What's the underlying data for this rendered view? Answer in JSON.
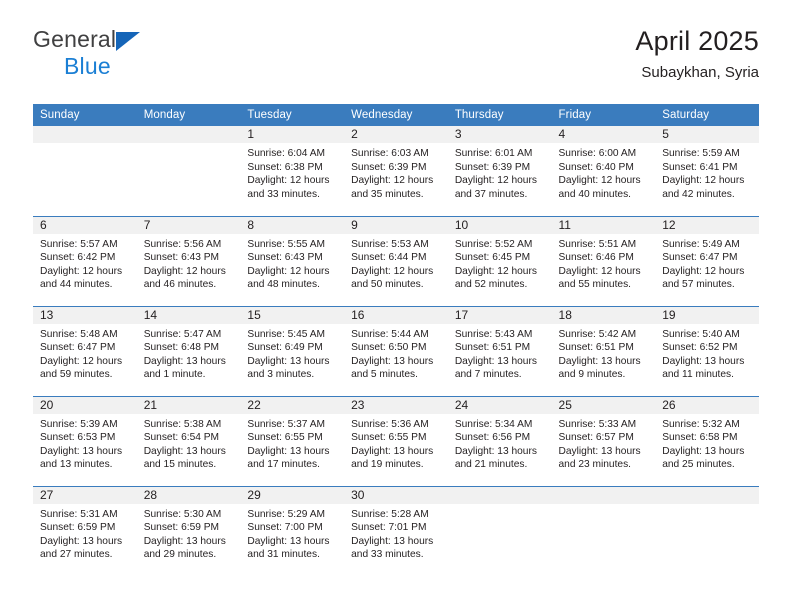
{
  "brand": {
    "name_line1": "General",
    "name_line2": "Blue",
    "triangle_color": "#1565b8",
    "blue_text_color": "#1b7fd4"
  },
  "header": {
    "title": "April 2025",
    "subtitle": "Subaykhan, Syria"
  },
  "theme": {
    "header_row_bg": "#3a7cbe",
    "header_row_text": "#ffffff",
    "daynum_bg": "#f1f1f1",
    "row_divider": "#3a7cbe",
    "body_text": "#231f20"
  },
  "calendar": {
    "weekday_headers": [
      "Sunday",
      "Monday",
      "Tuesday",
      "Wednesday",
      "Thursday",
      "Friday",
      "Saturday"
    ],
    "weeks": [
      [
        {
          "day": "",
          "sunrise": "",
          "sunset": "",
          "daylight": "",
          "empty": true
        },
        {
          "day": "",
          "sunrise": "",
          "sunset": "",
          "daylight": "",
          "empty": true
        },
        {
          "day": "1",
          "sunrise": "Sunrise: 6:04 AM",
          "sunset": "Sunset: 6:38 PM",
          "daylight": "Daylight: 12 hours and 33 minutes."
        },
        {
          "day": "2",
          "sunrise": "Sunrise: 6:03 AM",
          "sunset": "Sunset: 6:39 PM",
          "daylight": "Daylight: 12 hours and 35 minutes."
        },
        {
          "day": "3",
          "sunrise": "Sunrise: 6:01 AM",
          "sunset": "Sunset: 6:39 PM",
          "daylight": "Daylight: 12 hours and 37 minutes."
        },
        {
          "day": "4",
          "sunrise": "Sunrise: 6:00 AM",
          "sunset": "Sunset: 6:40 PM",
          "daylight": "Daylight: 12 hours and 40 minutes."
        },
        {
          "day": "5",
          "sunrise": "Sunrise: 5:59 AM",
          "sunset": "Sunset: 6:41 PM",
          "daylight": "Daylight: 12 hours and 42 minutes."
        }
      ],
      [
        {
          "day": "6",
          "sunrise": "Sunrise: 5:57 AM",
          "sunset": "Sunset: 6:42 PM",
          "daylight": "Daylight: 12 hours and 44 minutes."
        },
        {
          "day": "7",
          "sunrise": "Sunrise: 5:56 AM",
          "sunset": "Sunset: 6:43 PM",
          "daylight": "Daylight: 12 hours and 46 minutes."
        },
        {
          "day": "8",
          "sunrise": "Sunrise: 5:55 AM",
          "sunset": "Sunset: 6:43 PM",
          "daylight": "Daylight: 12 hours and 48 minutes."
        },
        {
          "day": "9",
          "sunrise": "Sunrise: 5:53 AM",
          "sunset": "Sunset: 6:44 PM",
          "daylight": "Daylight: 12 hours and 50 minutes."
        },
        {
          "day": "10",
          "sunrise": "Sunrise: 5:52 AM",
          "sunset": "Sunset: 6:45 PM",
          "daylight": "Daylight: 12 hours and 52 minutes."
        },
        {
          "day": "11",
          "sunrise": "Sunrise: 5:51 AM",
          "sunset": "Sunset: 6:46 PM",
          "daylight": "Daylight: 12 hours and 55 minutes."
        },
        {
          "day": "12",
          "sunrise": "Sunrise: 5:49 AM",
          "sunset": "Sunset: 6:47 PM",
          "daylight": "Daylight: 12 hours and 57 minutes."
        }
      ],
      [
        {
          "day": "13",
          "sunrise": "Sunrise: 5:48 AM",
          "sunset": "Sunset: 6:47 PM",
          "daylight": "Daylight: 12 hours and 59 minutes."
        },
        {
          "day": "14",
          "sunrise": "Sunrise: 5:47 AM",
          "sunset": "Sunset: 6:48 PM",
          "daylight": "Daylight: 13 hours and 1 minute."
        },
        {
          "day": "15",
          "sunrise": "Sunrise: 5:45 AM",
          "sunset": "Sunset: 6:49 PM",
          "daylight": "Daylight: 13 hours and 3 minutes."
        },
        {
          "day": "16",
          "sunrise": "Sunrise: 5:44 AM",
          "sunset": "Sunset: 6:50 PM",
          "daylight": "Daylight: 13 hours and 5 minutes."
        },
        {
          "day": "17",
          "sunrise": "Sunrise: 5:43 AM",
          "sunset": "Sunset: 6:51 PM",
          "daylight": "Daylight: 13 hours and 7 minutes."
        },
        {
          "day": "18",
          "sunrise": "Sunrise: 5:42 AM",
          "sunset": "Sunset: 6:51 PM",
          "daylight": "Daylight: 13 hours and 9 minutes."
        },
        {
          "day": "19",
          "sunrise": "Sunrise: 5:40 AM",
          "sunset": "Sunset: 6:52 PM",
          "daylight": "Daylight: 13 hours and 11 minutes."
        }
      ],
      [
        {
          "day": "20",
          "sunrise": "Sunrise: 5:39 AM",
          "sunset": "Sunset: 6:53 PM",
          "daylight": "Daylight: 13 hours and 13 minutes."
        },
        {
          "day": "21",
          "sunrise": "Sunrise: 5:38 AM",
          "sunset": "Sunset: 6:54 PM",
          "daylight": "Daylight: 13 hours and 15 minutes."
        },
        {
          "day": "22",
          "sunrise": "Sunrise: 5:37 AM",
          "sunset": "Sunset: 6:55 PM",
          "daylight": "Daylight: 13 hours and 17 minutes."
        },
        {
          "day": "23",
          "sunrise": "Sunrise: 5:36 AM",
          "sunset": "Sunset: 6:55 PM",
          "daylight": "Daylight: 13 hours and 19 minutes."
        },
        {
          "day": "24",
          "sunrise": "Sunrise: 5:34 AM",
          "sunset": "Sunset: 6:56 PM",
          "daylight": "Daylight: 13 hours and 21 minutes."
        },
        {
          "day": "25",
          "sunrise": "Sunrise: 5:33 AM",
          "sunset": "Sunset: 6:57 PM",
          "daylight": "Daylight: 13 hours and 23 minutes."
        },
        {
          "day": "26",
          "sunrise": "Sunrise: 5:32 AM",
          "sunset": "Sunset: 6:58 PM",
          "daylight": "Daylight: 13 hours and 25 minutes."
        }
      ],
      [
        {
          "day": "27",
          "sunrise": "Sunrise: 5:31 AM",
          "sunset": "Sunset: 6:59 PM",
          "daylight": "Daylight: 13 hours and 27 minutes."
        },
        {
          "day": "28",
          "sunrise": "Sunrise: 5:30 AM",
          "sunset": "Sunset: 6:59 PM",
          "daylight": "Daylight: 13 hours and 29 minutes."
        },
        {
          "day": "29",
          "sunrise": "Sunrise: 5:29 AM",
          "sunset": "Sunset: 7:00 PM",
          "daylight": "Daylight: 13 hours and 31 minutes."
        },
        {
          "day": "30",
          "sunrise": "Sunrise: 5:28 AM",
          "sunset": "Sunset: 7:01 PM",
          "daylight": "Daylight: 13 hours and 33 minutes."
        },
        {
          "day": "",
          "sunrise": "",
          "sunset": "",
          "daylight": "",
          "empty": true
        },
        {
          "day": "",
          "sunrise": "",
          "sunset": "",
          "daylight": "",
          "empty": true
        },
        {
          "day": "",
          "sunrise": "",
          "sunset": "",
          "daylight": "",
          "empty": true
        }
      ]
    ]
  }
}
